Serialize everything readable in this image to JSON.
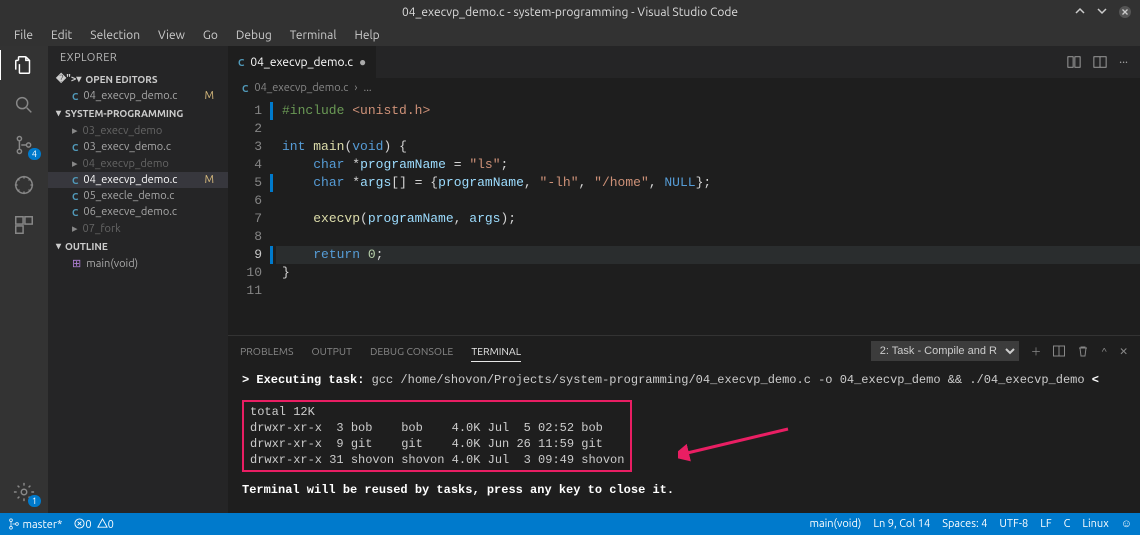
{
  "titlebar": {
    "title": "04_execvp_demo.c - system-programming - Visual Studio Code"
  },
  "menubar": [
    "File",
    "Edit",
    "Selection",
    "View",
    "Go",
    "Debug",
    "Terminal",
    "Help"
  ],
  "activity": {
    "scm_badge": "4",
    "settings_badge": "1"
  },
  "sidebar": {
    "header": "EXPLORER",
    "open_editors_title": "OPEN EDITORS",
    "open_editors": [
      {
        "name": "04_execvp_demo.c",
        "status": "M"
      }
    ],
    "project_title": "SYSTEM-PROGRAMMING",
    "files": [
      {
        "name": "03_execv_demo",
        "dim": true
      },
      {
        "name": "03_execv_demo.c"
      },
      {
        "name": "04_execvp_demo",
        "dim": true
      },
      {
        "name": "04_execvp_demo.c",
        "active": true,
        "status": "M"
      },
      {
        "name": "05_execle_demo.c"
      },
      {
        "name": "06_execve_demo.c"
      },
      {
        "name": "07_fork",
        "dim": true
      }
    ],
    "outline_title": "OUTLINE",
    "outline": [
      {
        "name": "main(void)"
      }
    ]
  },
  "tab": {
    "name": "04_execvp_demo.c"
  },
  "breadcrumb": {
    "file": "04_execvp_demo.c",
    "sep": "›",
    "more": "..."
  },
  "code": {
    "lines": [
      {
        "n": 1,
        "html": "<span class='k-grn'>#include</span> <span class='k-str'>&lt;unistd.h&gt;</span>"
      },
      {
        "n": 2,
        "html": ""
      },
      {
        "n": 3,
        "html": "<span class='k-blue'>int</span> <span class='k-yel'>main</span><span class='k-def'>(</span><span class='k-blue'>void</span><span class='k-def'>) {</span>"
      },
      {
        "n": 4,
        "html": "    <span class='k-blue'>char</span> <span class='k-def'>*</span><span class='k-lblue'>programName</span> <span class='k-def'>=</span> <span class='k-str'>\"ls\"</span><span class='k-def'>;</span>"
      },
      {
        "n": 5,
        "html": "    <span class='k-blue'>char</span> <span class='k-def'>*</span><span class='k-lblue'>args</span><span class='k-def'>[] = {</span><span class='k-lblue'>programName</span><span class='k-def'>, </span><span class='k-str'>\"-lh\"</span><span class='k-def'>, </span><span class='k-str'>\"/home\"</span><span class='k-def'>, </span><span class='k-blue'>NULL</span><span class='k-def'>};</span>"
      },
      {
        "n": 6,
        "html": ""
      },
      {
        "n": 7,
        "html": "    <span class='k-yel'>execvp</span><span class='k-def'>(</span><span class='k-lblue'>programName</span><span class='k-def'>, </span><span class='k-lblue'>args</span><span class='k-def'>);</span>"
      },
      {
        "n": 8,
        "html": ""
      },
      {
        "n": 9,
        "html": "    <span class='k-blue'>return</span> <span class='k-num'>0</span><span class='k-def'>;</span>",
        "current": true
      },
      {
        "n": 10,
        "html": "<span class='k-def'>}</span>"
      },
      {
        "n": 11,
        "html": ""
      }
    ]
  },
  "panel": {
    "tabs": {
      "problems": "PROBLEMS",
      "output": "OUTPUT",
      "debug": "DEBUG CONSOLE",
      "terminal": "TERMINAL"
    },
    "task": "2: Task - Compile and R",
    "exec_prefix": "> Executing task: ",
    "exec_cmd": "gcc /home/shovon/Projects/system-programming/04_execvp_demo.c -o 04_execvp_demo && ./04_execvp_demo ",
    "exec_suffix": "<",
    "ls": [
      "total 12K",
      "drwxr-xr-x  3 bob    bob    4.0K Jul  5 02:52 bob",
      "drwxr-xr-x  9 git    git    4.0K Jun 26 11:59 git",
      "drwxr-xr-x 31 shovon shovon 4.0K Jul  3 09:49 shovon"
    ],
    "reuse": "Terminal will be reused by tasks, press any key to close it."
  },
  "statusbar": {
    "branch": "master*",
    "errors": "0",
    "warnings": "0",
    "scope": "main(void)",
    "position": "Ln 9, Col 14",
    "spaces": "Spaces: 4",
    "encoding": "UTF-8",
    "eol": "LF",
    "lang": "C",
    "os": "Linux"
  }
}
